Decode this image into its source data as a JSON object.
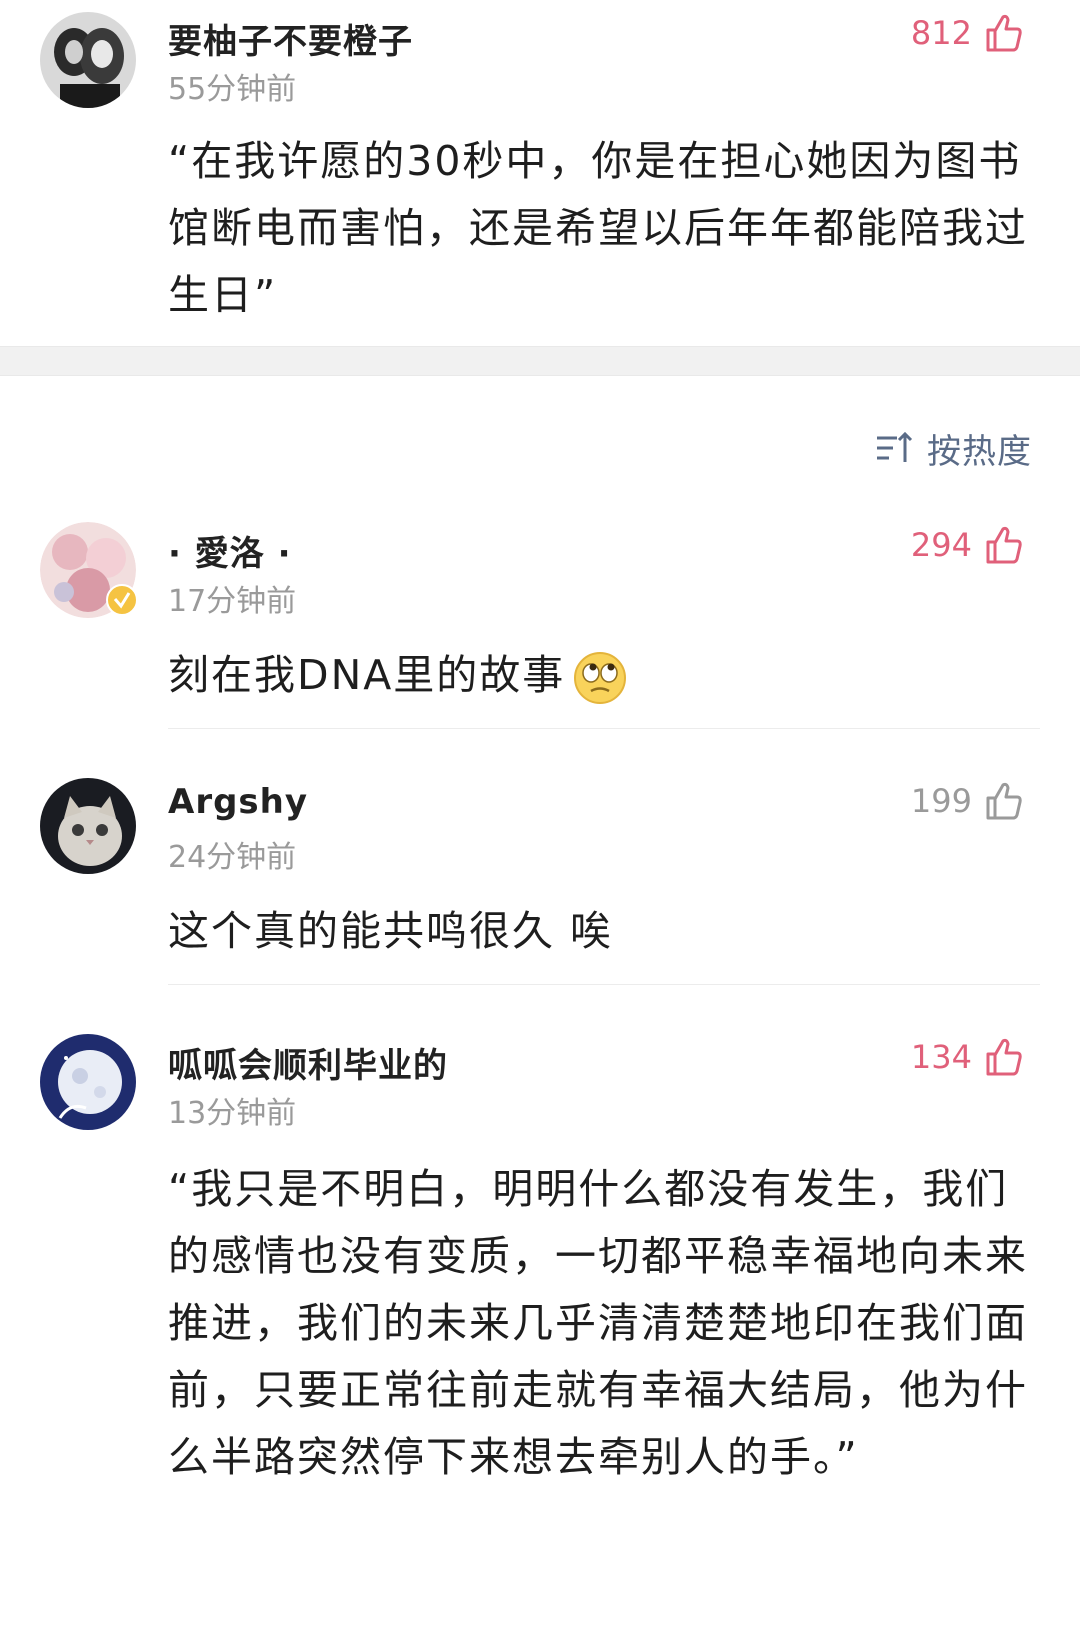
{
  "top_comment": {
    "username": "要柚子不要橙子",
    "time": "55分钟前",
    "likes": "812",
    "text": "“在我许愿的30秒中，你是在担心她因为图书馆断电而害怕，还是希望以后年年都能陪我过生日”"
  },
  "sort": {
    "label": "按热度",
    "icon": "sort-icon"
  },
  "comments": [
    {
      "username": "· 愛洛 ·",
      "time": "17分钟前",
      "likes": "294",
      "text": "刻在我DNA里的故事",
      "emoji": "eye-roll-emoji",
      "verified": true
    },
    {
      "username": "Argshy",
      "time": "24分钟前",
      "likes": "199",
      "text": "这个真的能共鸣很久 唉"
    },
    {
      "username": "呱呱会顺利毕业的",
      "time": "13分钟前",
      "likes": "134",
      "text": "“我只是不明白，明明什么都没有发生，我们的感情也没有变质，一切都平稳幸福地向未来推进，我们的未来几乎清清楚楚地印在我们面前，只要正常往前走就有幸福大结局，他为什么半路突然停下来想去牵别人的手。”"
    }
  ],
  "colors": {
    "like_active": "#e0607a",
    "like_inactive": "#9a9a9a",
    "sort_text": "#5a6b87",
    "verified_badge": "#f5c342"
  }
}
